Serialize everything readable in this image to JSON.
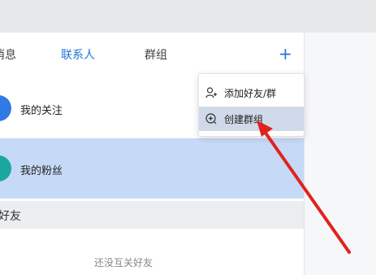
{
  "tabs": {
    "messages": "消息",
    "contacts": "联系人",
    "groups": "群组",
    "add": "+"
  },
  "contacts": {
    "follow": "我的关注",
    "fans": "我的粉丝"
  },
  "section": {
    "title": "好友"
  },
  "empty_text": "还没互关好友",
  "menu": {
    "add_friend": "添加好友/群",
    "create_group": "创建群组"
  },
  "colors": {
    "accent": "#1e73d8",
    "selected_row": "#c6d9f7",
    "arrow": "#e0231c"
  },
  "icons": {
    "add_friend": "person-plus-icon",
    "create_group": "add-circle-icon"
  }
}
